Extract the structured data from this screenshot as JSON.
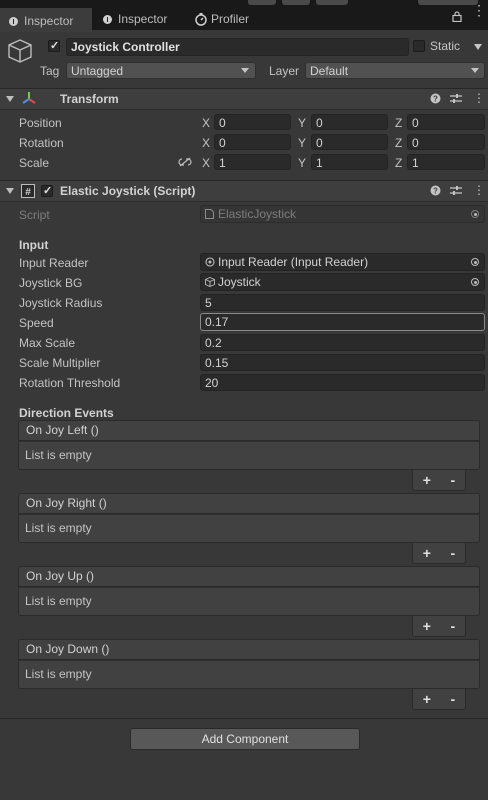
{
  "tabs": [
    {
      "label": "Inspector",
      "icon": "info-icon"
    },
    {
      "label": "Inspector",
      "icon": "info-icon"
    },
    {
      "label": "Profiler",
      "icon": "profiler-icon"
    }
  ],
  "gameobject": {
    "name": "Joystick Controller",
    "active": true,
    "static_label": "Static",
    "tag_label": "Tag",
    "tag_value": "Untagged",
    "layer_label": "Layer",
    "layer_value": "Default"
  },
  "transform": {
    "title": "Transform",
    "rows": [
      {
        "label": "Position",
        "x": "0",
        "y": "0",
        "z": "0"
      },
      {
        "label": "Rotation",
        "x": "0",
        "y": "0",
        "z": "0"
      },
      {
        "label": "Scale",
        "x": "1",
        "y": "1",
        "z": "1"
      }
    ],
    "axis": {
      "x": "X",
      "y": "Y",
      "z": "Z"
    }
  },
  "script_component": {
    "title": "Elastic Joystick (Script)",
    "script_label": "Script",
    "script_value": "ElasticJoystick",
    "section_input": "Input",
    "fields": {
      "input_reader": {
        "label": "Input Reader",
        "value": "Input Reader (Input Reader)"
      },
      "joystick_bg": {
        "label": "Joystick BG",
        "value": "Joystick"
      },
      "joystick_radius": {
        "label": "Joystick Radius",
        "value": "5"
      },
      "speed": {
        "label": "Speed",
        "value": "0.17"
      },
      "max_scale": {
        "label": "Max Scale",
        "value": "0.2"
      },
      "scale_multiplier": {
        "label": "Scale Multiplier",
        "value": "0.15"
      },
      "rotation_threshold": {
        "label": "Rotation Threshold",
        "value": "20"
      }
    },
    "section_events": "Direction Events",
    "events": [
      {
        "title": "On Joy Left ()",
        "body": "List is empty"
      },
      {
        "title": "On Joy Right ()",
        "body": "List is empty"
      },
      {
        "title": "On Joy Up ()",
        "body": "List is empty"
      },
      {
        "title": "On Joy Down ()",
        "body": "List is empty"
      }
    ],
    "plus": "+",
    "minus": "-"
  },
  "add_component": "Add Component"
}
